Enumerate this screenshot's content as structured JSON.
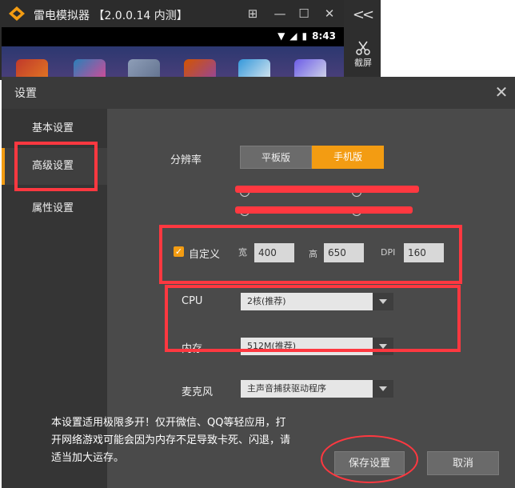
{
  "emulator": {
    "title": "雷电模拟器 【2.0.0.14 内测】",
    "time": "8:43",
    "screenshot_label": "截屏",
    "collapse_label": "<<",
    "window_buttons": {
      "skin": "⊞",
      "minimize": "—",
      "maximize": "☐",
      "close": "✕"
    }
  },
  "dialog": {
    "title": "设置",
    "close_glyph": "✕"
  },
  "nav": [
    {
      "label": "基本设置"
    },
    {
      "label": "高级设置"
    },
    {
      "label": "属性设置"
    }
  ],
  "resolution": {
    "label": "分辨率",
    "tabs": [
      "平板版",
      "手机版"
    ],
    "selected_tab": "手机版"
  },
  "custom": {
    "checkbox_label": "自定义",
    "checked": true,
    "width_label": "宽",
    "width": "400",
    "height_label": "高",
    "height": "650",
    "dpi_label": "DPI",
    "dpi": "160"
  },
  "cpu": {
    "label": "CPU",
    "value": "2核(推荐)"
  },
  "memory": {
    "label": "内存",
    "value": "512M(推荐)"
  },
  "mic": {
    "label": "麦克风",
    "value": "主声音捕获驱动程序"
  },
  "hint": "本设置适用极限多开！仅开微信、QQ等轻应用，打开网络游戏可能会因为内存不足导致卡死、闪退，请适当加大运存。",
  "buttons": {
    "save": "保存设置",
    "cancel": "取消"
  },
  "colors": {
    "accent": "#f39c12",
    "annotation_red": "#ff3840"
  }
}
